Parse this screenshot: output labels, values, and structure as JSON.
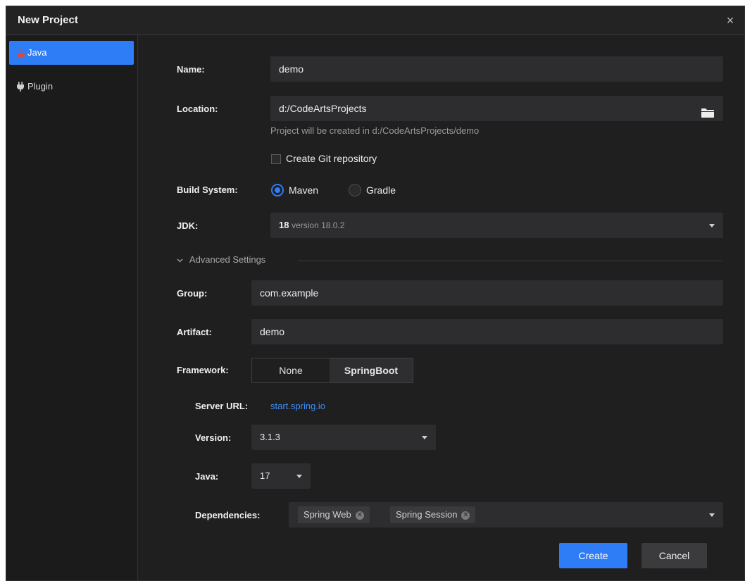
{
  "dialog": {
    "title": "New Project",
    "close_symbol": "×"
  },
  "sidebar": {
    "items": [
      {
        "label": "Java",
        "icon": "java-icon",
        "active": true
      },
      {
        "label": "Plugin",
        "icon": "plug-icon",
        "active": false
      }
    ]
  },
  "form": {
    "name_label": "Name:",
    "name_value": "demo",
    "location_label": "Location:",
    "location_value": "d:/CodeArtsProjects",
    "location_hint": "Project will be created in d:/CodeArtsProjects/demo",
    "git_label": "Create Git repository",
    "build_label": "Build System:",
    "build_options": [
      "Maven",
      "Gradle"
    ],
    "build_selected": "Maven",
    "jdk_label": "JDK:",
    "jdk_version": "18",
    "jdk_detail": "version 18.0.2"
  },
  "advanced": {
    "title": "Advanced Settings",
    "group_label": "Group:",
    "group_value": "com.example",
    "artifact_label": "Artifact:",
    "artifact_value": "demo",
    "framework_label": "Framework:",
    "framework_options": [
      "None",
      "SpringBoot"
    ],
    "framework_selected": "SpringBoot",
    "server_label": "Server URL:",
    "server_value": "start.spring.io",
    "version_label": "Version:",
    "version_value": "3.1.3",
    "java_label": "Java:",
    "java_value": "17",
    "deps_label": "Dependencies:",
    "dependencies": [
      "Spring Web",
      "Spring Session"
    ]
  },
  "buttons": {
    "create": "Create",
    "cancel": "Cancel"
  },
  "colors": {
    "accent": "#2f7df6",
    "background": "#1f1f20",
    "field": "#2d2d2f"
  }
}
